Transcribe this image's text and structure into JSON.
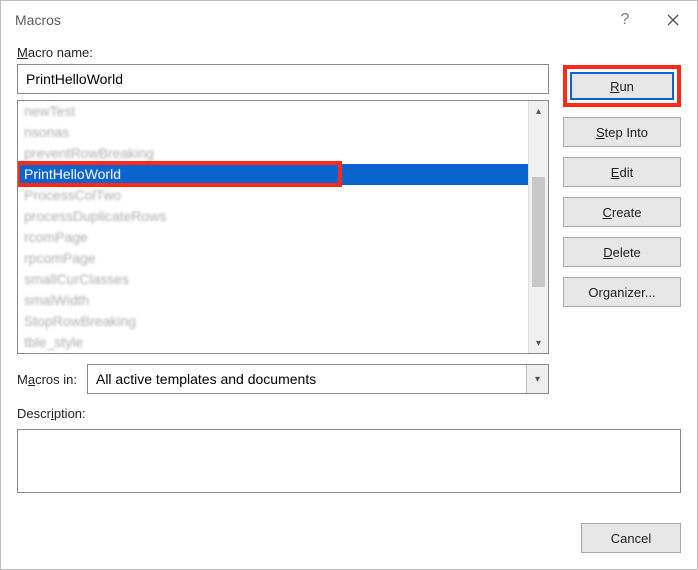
{
  "title": "Macros",
  "labels": {
    "macro_name": "Macro name:",
    "macros_in": "Macros in:",
    "description": "Description:"
  },
  "macro_name_value": "PrintHelloWorld",
  "list": {
    "items": [
      "newTest",
      "nsonas",
      "preventRowBreaking",
      "PrintHelloWorld",
      "ProcessColTwo",
      "processDuplicateRows",
      "rcomPage",
      "rpcomPage",
      "smallCurClasses",
      "smalWidth",
      "StopRowBreaking",
      "tble_style"
    ],
    "selected_index": 3
  },
  "buttons": {
    "run": "Run",
    "step_into": "Step Into",
    "edit": "Edit",
    "create": "Create",
    "delete": "Delete",
    "organizer": "Organizer...",
    "cancel": "Cancel"
  },
  "macros_in_value": "All active templates and documents",
  "description_value": ""
}
